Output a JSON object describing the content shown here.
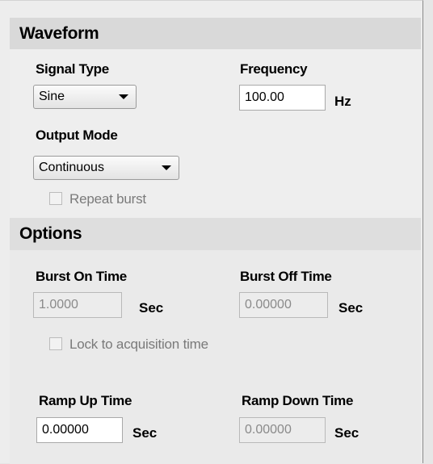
{
  "waveform": {
    "header": "Waveform",
    "signal_type": {
      "label": "Signal Type",
      "value": "Sine"
    },
    "frequency": {
      "label": "Frequency",
      "value": "100.00",
      "unit": "Hz"
    },
    "output_mode": {
      "label": "Output Mode",
      "value": "Continuous"
    },
    "repeat_burst": {
      "label": "Repeat burst",
      "checked": false,
      "enabled": false
    }
  },
  "options": {
    "header": "Options",
    "burst_on_time": {
      "label": "Burst On Time",
      "value": "1.0000",
      "unit": "Sec",
      "enabled": false
    },
    "burst_off_time": {
      "label": "Burst Off Time",
      "value": "0.00000",
      "unit": "Sec",
      "enabled": false
    },
    "lock_to_acquisition": {
      "label": "Lock to acquisition time",
      "checked": false,
      "enabled": false
    },
    "ramp_up_time": {
      "label": "Ramp Up Time",
      "value": "0.00000",
      "unit": "Sec",
      "enabled": true
    },
    "ramp_down_time": {
      "label": "Ramp Down Time",
      "value": "0.00000",
      "unit": "Sec",
      "enabled": false
    }
  }
}
